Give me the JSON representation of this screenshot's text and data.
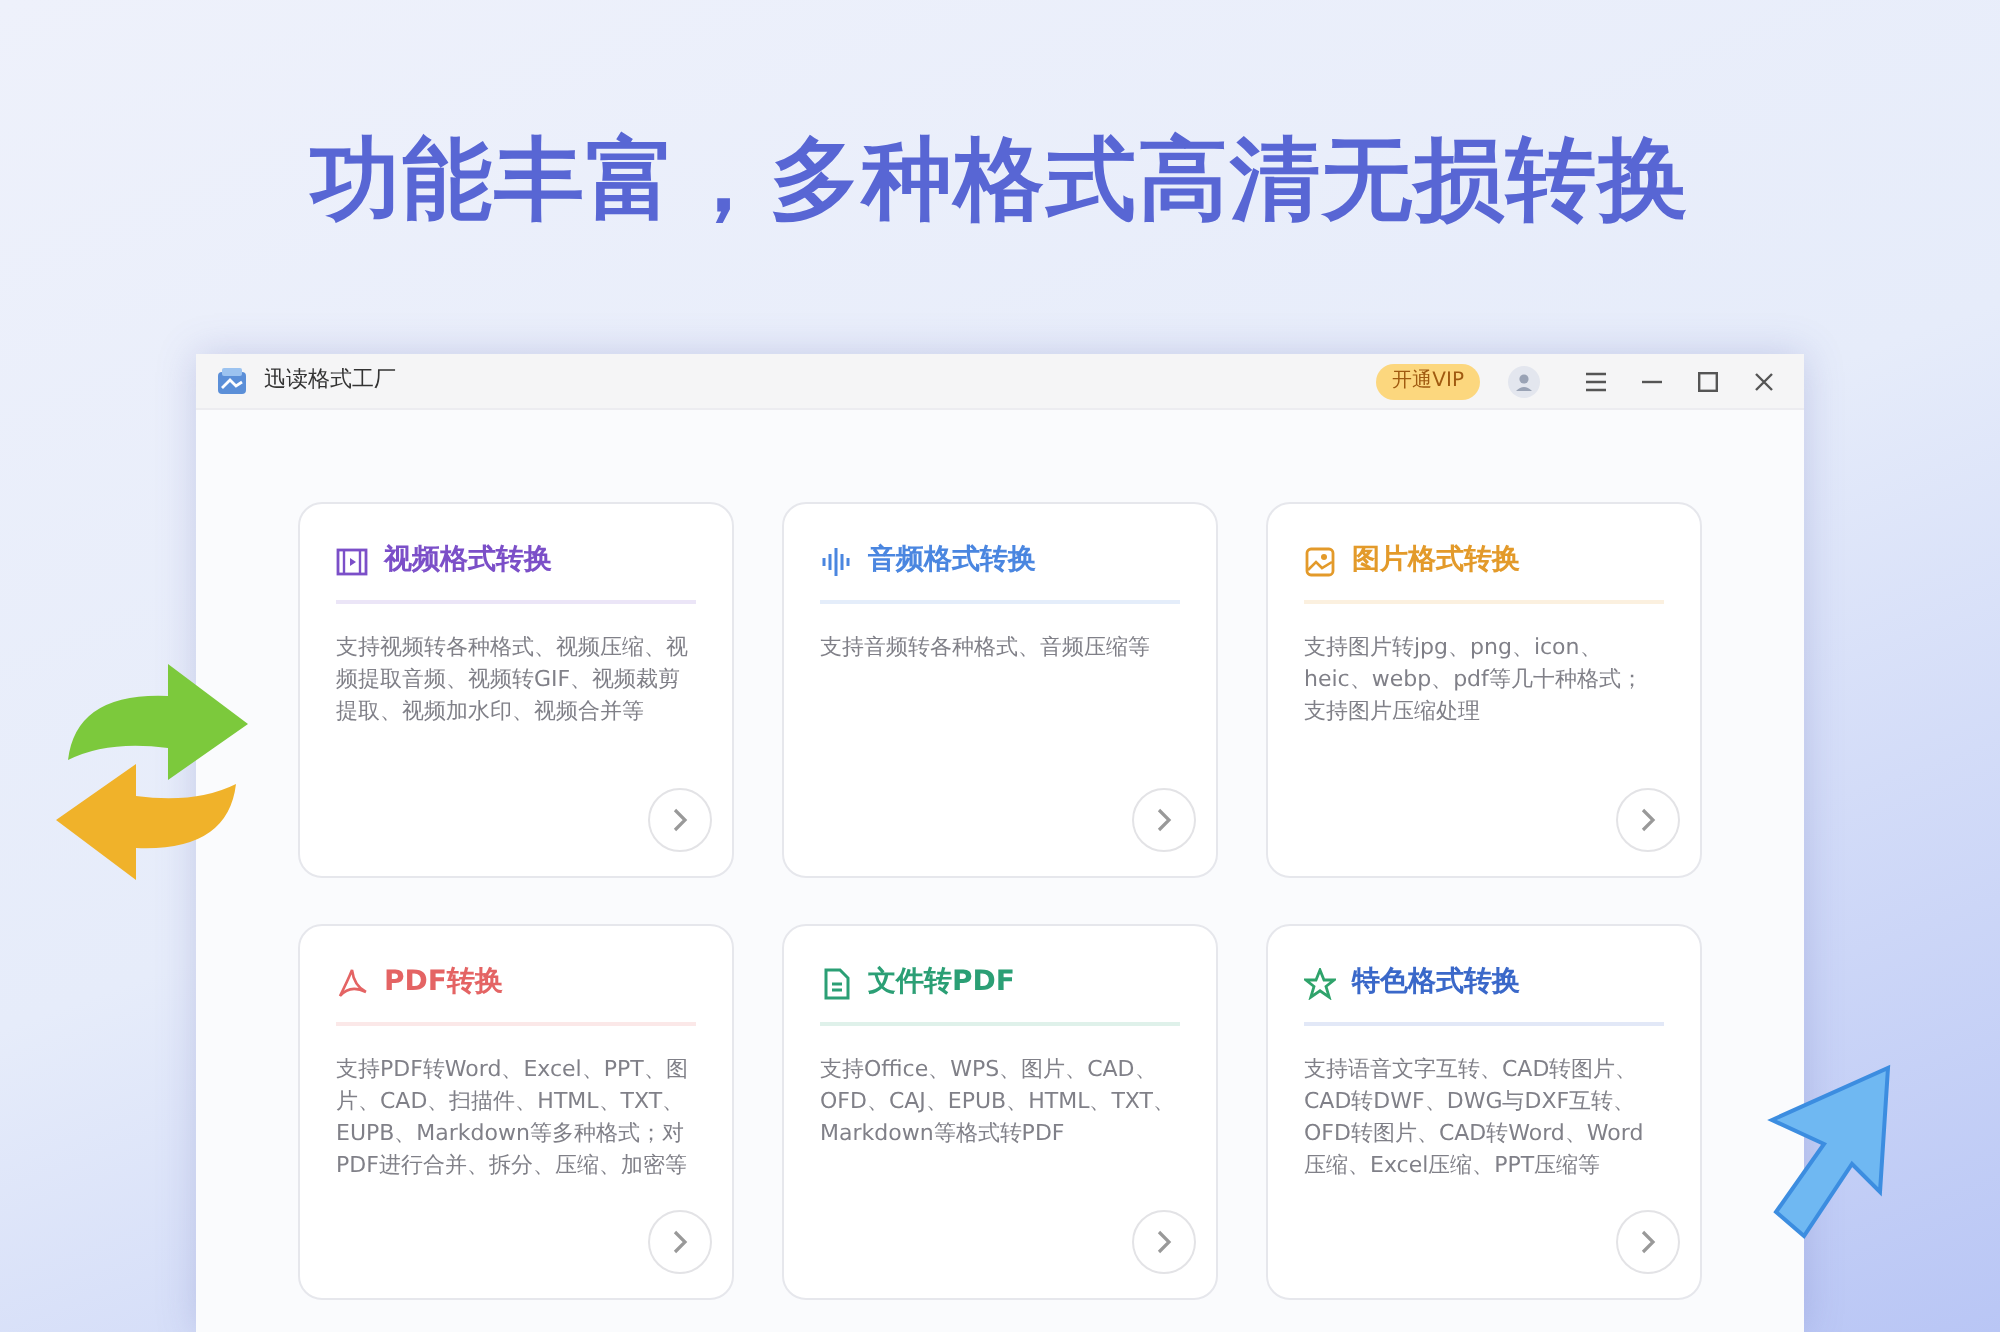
{
  "headline": "功能丰富，多种格式高清无损转换",
  "window": {
    "title": "迅读格式工厂",
    "vip_button": "开通VIP"
  },
  "cards": [
    {
      "kind": "video",
      "title": "视频格式转换",
      "color": "#7b4fc8",
      "description": "支持视频转各种格式、视频压缩、视频提取音频、视频转GIF、视频裁剪提取、视频加水印、视频合并等"
    },
    {
      "kind": "audio",
      "title": "音频格式转换",
      "color": "#4a86e0",
      "description": "支持音频转各种格式、音频压缩等"
    },
    {
      "kind": "image",
      "title": "图片格式转换",
      "color": "#e39a2a",
      "description": "支持图片转jpg、png、icon、heic、webp、pdf等几十种格式；支持图片压缩处理"
    },
    {
      "kind": "pdf",
      "title": "PDF转换",
      "color": "#e46464",
      "description": "支持PDF转Word、Excel、PPT、图片、CAD、扫描件、HTML、TXT、EUPB、Markdown等多种格式；对PDF进行合并、拆分、压缩、加密等"
    },
    {
      "kind": "file",
      "title": "文件转PDF",
      "color": "#2b9f75",
      "description": "支持Office、WPS、图片、CAD、OFD、CAJ、EPUB、HTML、TXT、Markdown等格式转PDF"
    },
    {
      "kind": "star",
      "title": "特色格式转换",
      "color": "#3a68c9",
      "description": "支持语音文字互转、CAD转图片、CAD转DWF、DWG与DXF互转、OFD转图片、CAD转Word、Word压缩、Excel压缩、PPT压缩等"
    }
  ]
}
